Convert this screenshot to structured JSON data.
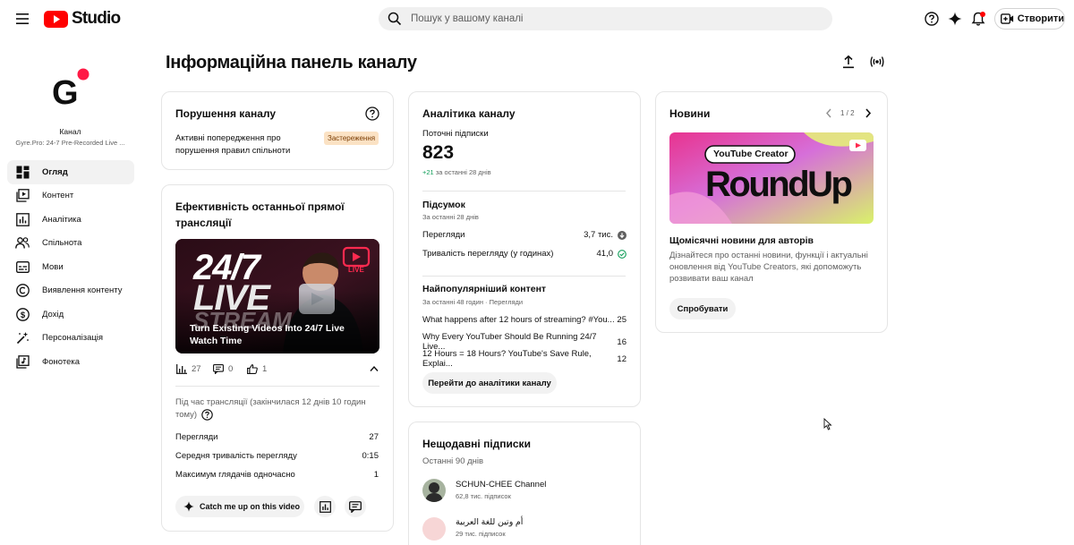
{
  "topbar": {
    "logo_text": "Studio",
    "search_placeholder": "Пошук у вашому каналі",
    "create_label": "Створити"
  },
  "sidebar": {
    "channel_caption": "Канал",
    "channel_name": "Gyre.Pro: 24-7 Pre-Recorded Live ...",
    "items": [
      {
        "label": "Огляд",
        "icon": "dashboard-icon",
        "active": true
      },
      {
        "label": "Контент",
        "icon": "content-icon",
        "active": false
      },
      {
        "label": "Аналітика",
        "icon": "analytics-icon",
        "active": false
      },
      {
        "label": "Спільнота",
        "icon": "community-icon",
        "active": false
      },
      {
        "label": "Мови",
        "icon": "subtitles-icon",
        "active": false
      },
      {
        "label": "Виявлення контенту",
        "icon": "copyright-icon",
        "active": false
      },
      {
        "label": "Дохід",
        "icon": "earn-icon",
        "active": false
      },
      {
        "label": "Персоналізація",
        "icon": "customization-icon",
        "active": false
      },
      {
        "label": "Фонотека",
        "icon": "audio-library-icon",
        "active": false
      }
    ]
  },
  "page": {
    "title": "Інформаційна панель каналу"
  },
  "violations": {
    "title": "Порушення каналу",
    "text_line1": "Активні попередження про",
    "text_line2": "порушення правил спільноти",
    "badge": "Застереження"
  },
  "live": {
    "title_line1": "Ефективність останньої прямої",
    "title_line2": "трансляції",
    "thumb_big1": "24/7",
    "thumb_big2": "LIVE",
    "thumb_big3": "STREAM",
    "thumb_live_tag": "LIVE",
    "thumb_caption_line1": "Turn Existing Videos Into 24/7 Live",
    "thumb_caption_line2": "Watch Time",
    "views_count": "27",
    "comments_count": "0",
    "likes_count": "1",
    "during_line1": "Під час трансляції (закінчилася 12 днів 10 годин",
    "during_line2": "тому)",
    "stats": [
      {
        "label": "Перегляди",
        "value": "27"
      },
      {
        "label": "Середня тривалість перегляду",
        "value": "0:15"
      },
      {
        "label": "Максимум глядачів одночасно",
        "value": "1"
      }
    ],
    "catch_label": "Catch me up on this video"
  },
  "analytics": {
    "title": "Аналітика каналу",
    "subs_label": "Поточні підписки",
    "subs_value": "823",
    "subs_delta_value": "+21",
    "subs_delta_period": "за останні 28 днів",
    "summary_title": "Підсумок",
    "summary_period": "За останні 28 днів",
    "summary_rows": [
      {
        "label": "Перегляди",
        "value": "3,7 тис."
      },
      {
        "label": "Тривалість перегляду (у годинах)",
        "value": "41,0"
      }
    ],
    "top_title": "Найпопулярніший контент",
    "top_period": "За останні 48 годин · Перегляди",
    "top_rows": [
      {
        "label": "What happens after 12 hours of streaming? #You...",
        "value": "25"
      },
      {
        "label": "Why Every YouTuber Should Be Running 24/7 Live...",
        "value": "16"
      },
      {
        "label": "12 Hours = 18 Hours? YouTube's Save Rule, Explai...",
        "value": "12"
      }
    ],
    "button_label": "Перейти до аналітики каналу"
  },
  "recent_subs": {
    "title": "Нещодавні підписки",
    "period": "Останні 90 днів",
    "items": [
      {
        "name": "SCHUN-CHEE Channel",
        "subs": "62,8 тис. підписок"
      },
      {
        "name": "أم وتين للغة العربية",
        "subs": "29 тис. підписок"
      }
    ]
  },
  "news": {
    "title": "Новини",
    "pager": "1 / 2",
    "image_tag": "YouTube Creator",
    "image_title": "RoundUp",
    "headline": "Щомісячні новини для авторів",
    "desc_line1": "Дізнайтеся про останні новини, функції і актуальні",
    "desc_line2": "оновлення від YouTube Creators, які допоможуть",
    "desc_line3": "розвивати ваш канал",
    "button_label": "Спробувати"
  },
  "colors": {
    "brand_red": "#ff0000",
    "green": "#0f9d58",
    "badge_bg": "#fbe2c4"
  }
}
